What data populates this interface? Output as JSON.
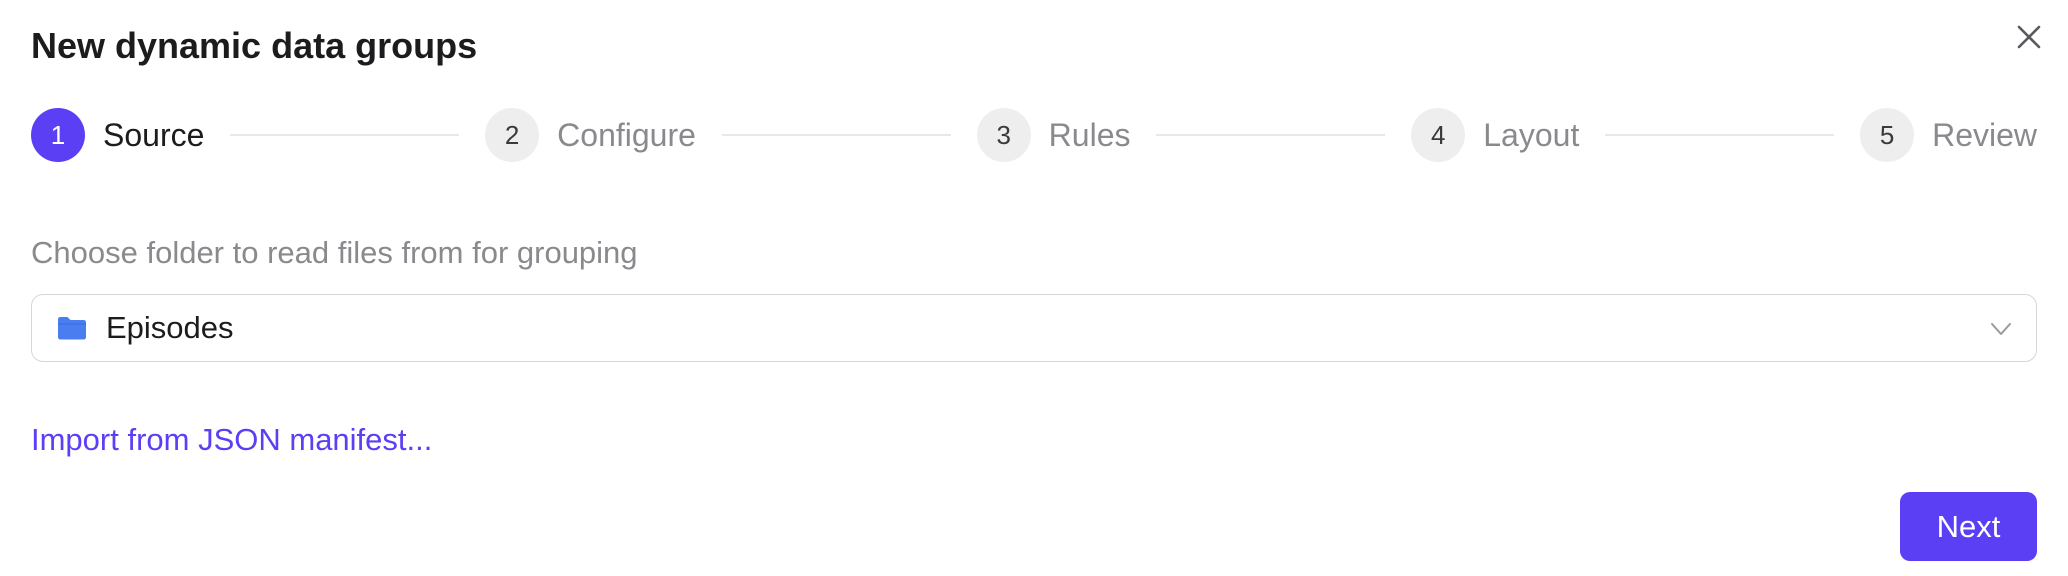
{
  "dialog": {
    "title": "New dynamic data groups",
    "close_icon": "close-icon"
  },
  "stepper": {
    "active_step": 1,
    "accent_color": "#5b3ff5",
    "steps": [
      {
        "number": "1",
        "label": "Source"
      },
      {
        "number": "2",
        "label": "Configure"
      },
      {
        "number": "3",
        "label": "Rules"
      },
      {
        "number": "4",
        "label": "Layout"
      },
      {
        "number": "5",
        "label": "Review"
      }
    ]
  },
  "source": {
    "prompt": "Choose folder to read files from for grouping",
    "selected_folder": "Episodes",
    "folder_icon": "folder-icon",
    "folder_icon_color": "#4a7ef0",
    "dropdown_icon": "chevron-down-icon"
  },
  "import_link": "Import from JSON manifest...",
  "footer": {
    "next_label": "Next"
  }
}
